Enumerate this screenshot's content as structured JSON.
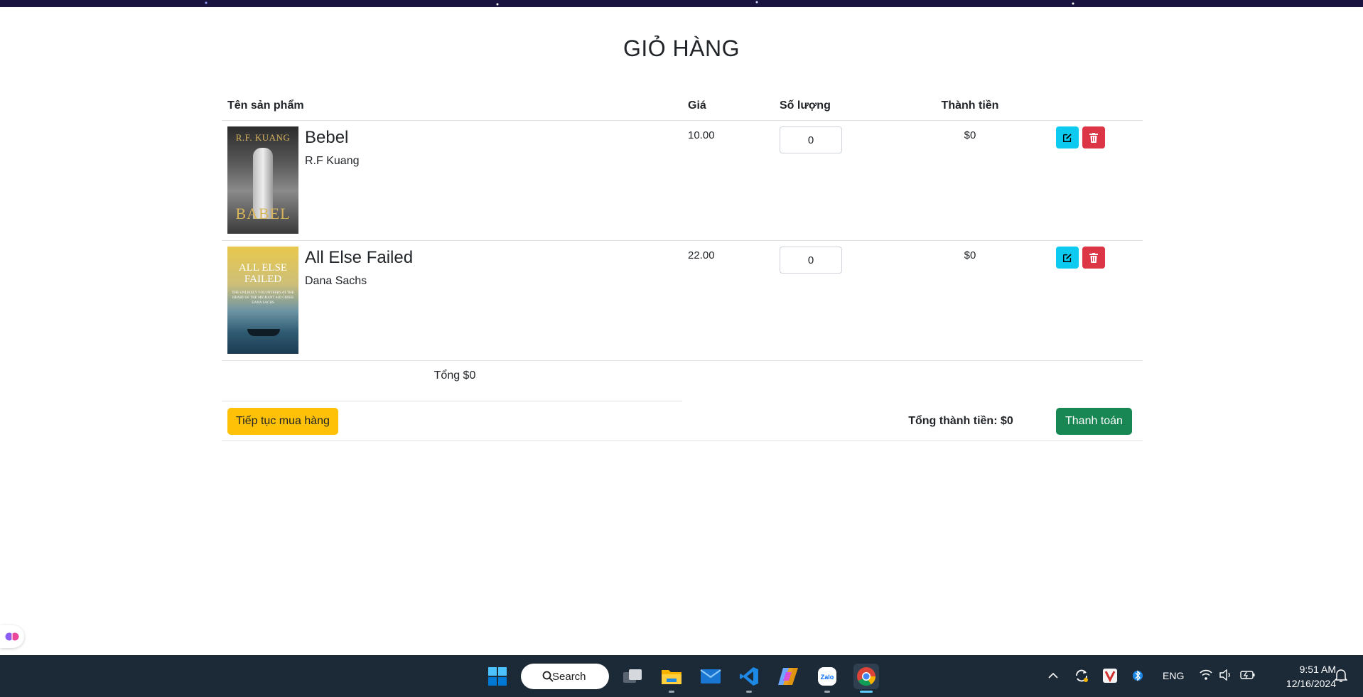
{
  "page": {
    "title": "GIỎ HÀNG"
  },
  "table": {
    "headers": {
      "name": "Tên sản phẩm",
      "price": "Giá",
      "quantity": "Số lượng",
      "total": "Thành tiền"
    },
    "rows": [
      {
        "name": "Bebel",
        "author": "R.F Kuang",
        "price": "10.00",
        "quantity": "0",
        "line_total": "$0",
        "cover": {
          "title_top": "R.F. KUANG",
          "title_bottom": "BABEL"
        }
      },
      {
        "name": "All Else Failed",
        "author": "Dana Sachs",
        "price": "22.00",
        "quantity": "0",
        "line_total": "$0",
        "cover": {
          "title": "ALL ELSE FAILED",
          "subtitle": "THE UNLIKELY VOLUNTEERS AT THE HEART OF THE MIGRANT AID CRISIS",
          "author": "DANA SACHS"
        }
      }
    ],
    "subtotal": "Tổng $0"
  },
  "footer": {
    "continue_label": "Tiếp tục mua hàng",
    "grand_total": "Tổng thành tiền: $0",
    "checkout_label": "Thanh toán"
  },
  "colors": {
    "edit": "#0dcaf0",
    "delete": "#dc3545",
    "continue": "#ffc107",
    "checkout": "#198754",
    "taskbar": "#1c2a38"
  },
  "taskbar": {
    "search_label": "Search",
    "apps": [
      "start-icon",
      "task-view-icon",
      "file-explorer-icon",
      "mail-icon",
      "vscode-icon",
      "copilot-icon",
      "zalo-icon",
      "chrome-icon"
    ],
    "zalo_label": "Zalo",
    "language": "ENG",
    "time": "9:51 AM",
    "date": "12/16/2024"
  }
}
